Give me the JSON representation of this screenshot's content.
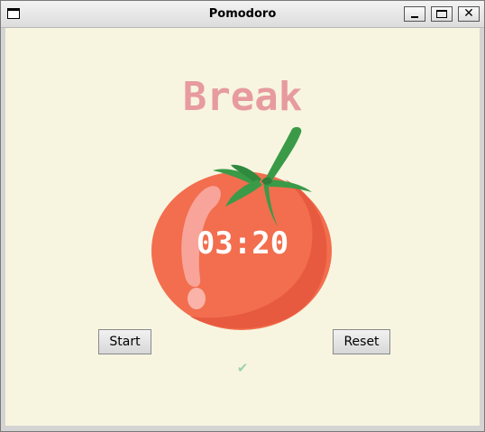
{
  "window": {
    "title": "Pomodoro",
    "close_glyph": "✕"
  },
  "app": {
    "mode_label": "Break",
    "time": "03:20",
    "start_label": "Start",
    "reset_label": "Reset",
    "checkmarks": "✔"
  },
  "colors": {
    "background": "#f7f5e0",
    "mode_label": "#e79b9e",
    "tomato": "#f26e4e",
    "leaves": "#3a9a48",
    "checkmark": "#9fd3a8"
  },
  "icons": [
    "window-icon",
    "minimize-icon",
    "maximize-icon",
    "close-icon",
    "tomato-icon",
    "checkmark-icon"
  ]
}
